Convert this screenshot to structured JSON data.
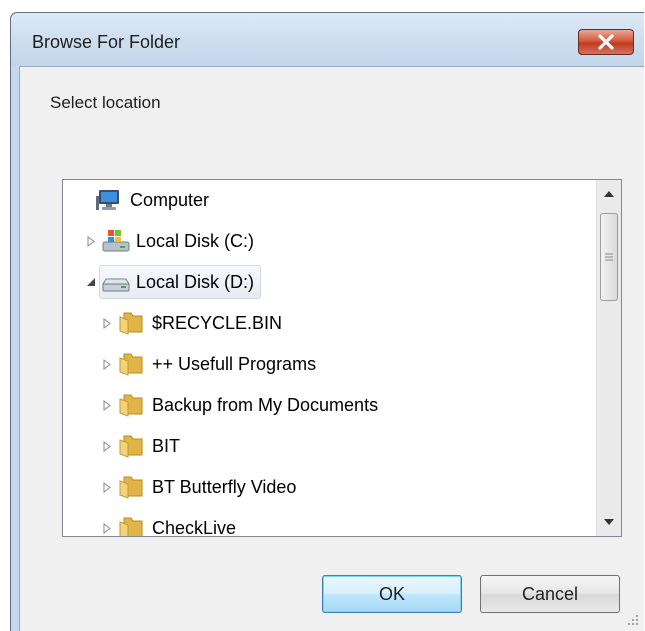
{
  "window": {
    "title": "Browse For Folder",
    "close_icon": "close-icon"
  },
  "instruction": "Select location",
  "tree": {
    "items": [
      {
        "label": "Computer",
        "icon": "computer-icon",
        "level": 0,
        "expander": "none",
        "selected": false
      },
      {
        "label": "Local Disk (C:)",
        "icon": "system-drive-icon",
        "level": 1,
        "expander": "collapsed",
        "selected": false
      },
      {
        "label": "Local Disk (D:)",
        "icon": "drive-icon",
        "level": 1,
        "expander": "expanded",
        "selected": true
      },
      {
        "label": "$RECYCLE.BIN",
        "icon": "folder-icon",
        "level": 2,
        "expander": "collapsed",
        "selected": false
      },
      {
        "label": "++ Usefull Programs",
        "icon": "folder-icon",
        "level": 2,
        "expander": "collapsed",
        "selected": false
      },
      {
        "label": "Backup from My Documents",
        "icon": "folder-icon",
        "level": 2,
        "expander": "collapsed",
        "selected": false
      },
      {
        "label": "BIT",
        "icon": "folder-icon",
        "level": 2,
        "expander": "collapsed",
        "selected": false
      },
      {
        "label": "BT Butterfly Video",
        "icon": "folder-icon",
        "level": 2,
        "expander": "collapsed",
        "selected": false
      },
      {
        "label": "CheckLive",
        "icon": "folder-icon",
        "level": 2,
        "expander": "collapsed",
        "selected": false
      }
    ]
  },
  "buttons": {
    "ok_label": "OK",
    "cancel_label": "Cancel"
  },
  "colors": {
    "selection_bg": "#e8ecf1",
    "default_button_border": "#3c7fb1",
    "close_button": "#c13a1f"
  }
}
